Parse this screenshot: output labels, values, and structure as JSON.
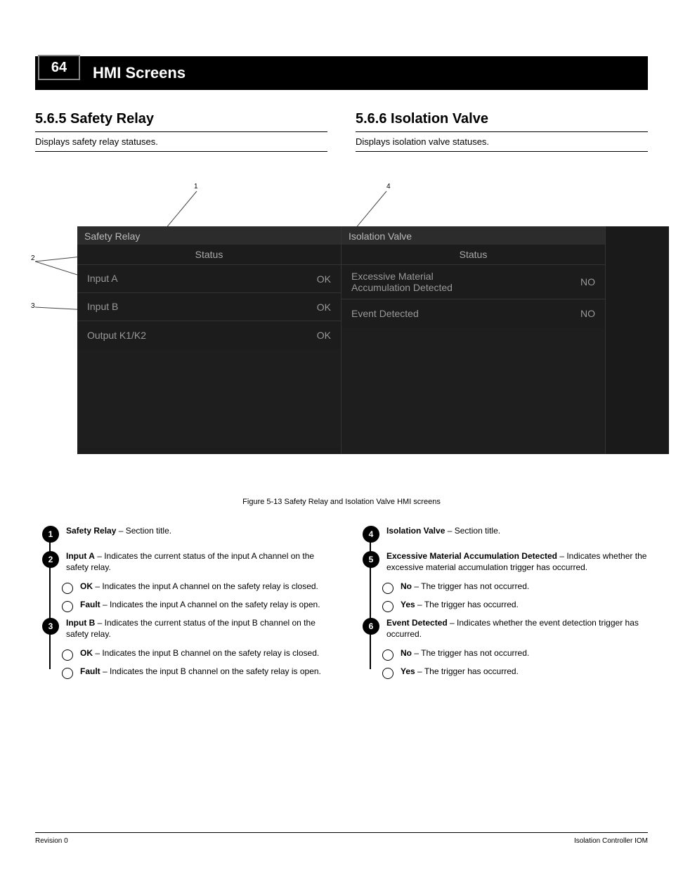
{
  "header": {
    "page_number": "64",
    "title": "HMI Screens"
  },
  "left_section": {
    "title": "5.6.5 Safety Relay",
    "subtitle": "Displays safety relay statuses."
  },
  "right_section": {
    "title": "5.6.6 Isolation Valve",
    "subtitle": "Displays isolation valve statuses."
  },
  "hmi": {
    "left": {
      "header": "Safety Relay",
      "sub": "Status",
      "rows": [
        {
          "label": "Input A",
          "value": "OK"
        },
        {
          "label": "Input B",
          "value": "OK"
        },
        {
          "label": "Output K1/K2",
          "value": "OK"
        }
      ]
    },
    "right": {
      "header": "Isolation Valve",
      "sub": "Status",
      "rows": [
        {
          "label": "Excessive Material\nAccumulation Detected",
          "value": "NO"
        },
        {
          "label": "Event Detected",
          "value": "NO"
        }
      ]
    }
  },
  "callouts": {
    "c1": "1",
    "c2": "2",
    "c3": "3",
    "c4": "4",
    "c5": "5",
    "c6": "6"
  },
  "figure_caption": "Figure 5-13  Safety Relay and Isolation Valve HMI screens",
  "left_items": {
    "a": {
      "num": "1",
      "title": "Safety Relay",
      "desc": " – Section title."
    },
    "b": {
      "num": "2",
      "title": "Input A",
      "desc": " – Indicates the current status of the input A channel on the safety relay.",
      "sub": [
        {
          "label": "OK",
          "desc": " – Indicates the input A channel on the safety relay is closed."
        },
        {
          "label": "Fault",
          "desc": " – Indicates the input A channel on the safety relay is open."
        }
      ]
    },
    "c": {
      "num": "3",
      "title": "Input B",
      "desc": " – Indicates the current status of the input B channel on the safety relay.",
      "sub": [
        {
          "label": "OK",
          "desc": " – Indicates the input B channel on the safety relay is closed."
        },
        {
          "label": "Fault",
          "desc": " – Indicates the input B channel on the safety relay is open."
        }
      ]
    }
  },
  "right_items": {
    "a": {
      "num": "4",
      "title": "Isolation Valve",
      "desc": " – Section title."
    },
    "b": {
      "num": "5",
      "title": "Excessive Material Accumulation Detected",
      "desc": " – Indicates whether the excessive material accumulation trigger has occurred.",
      "sub": [
        {
          "label": "No",
          "desc": " – The trigger has not occurred."
        },
        {
          "label": "Yes",
          "desc": " – The trigger has occurred."
        }
      ]
    },
    "c": {
      "num": "6",
      "title": "Event Detected",
      "desc": " – Indicates whether the event detection trigger has occurred.",
      "sub": [
        {
          "label": "No",
          "desc": " – The trigger has not occurred."
        },
        {
          "label": "Yes",
          "desc": " – The trigger has occurred."
        }
      ]
    }
  },
  "footer": {
    "left": "Revision 0",
    "right": "Isolation Controller IOM"
  }
}
